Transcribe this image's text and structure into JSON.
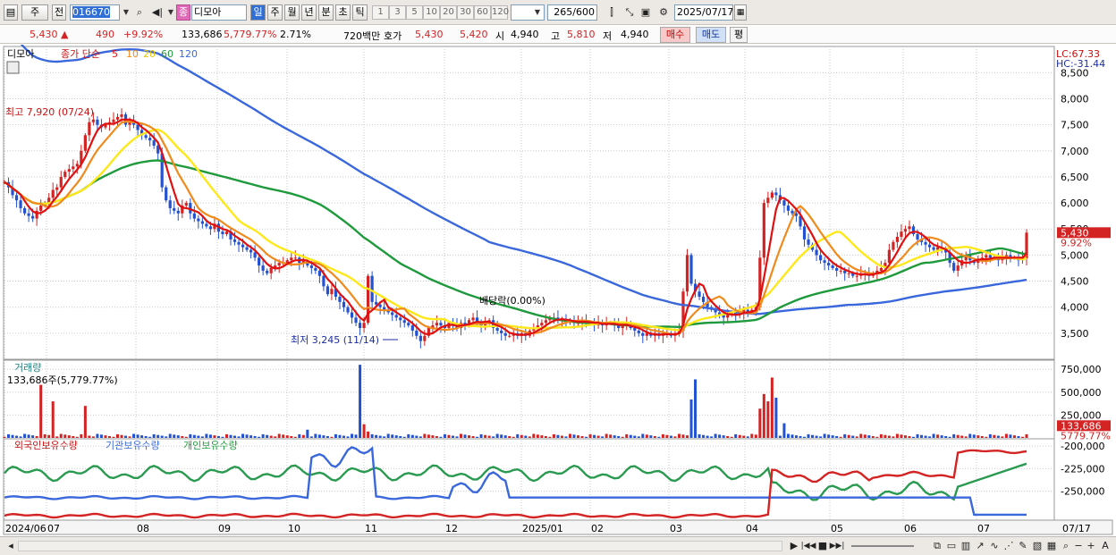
{
  "toolbar": {
    "market": "주",
    "prev": "전",
    "code": "016670",
    "name": "디모아",
    "name_tag": "종",
    "periods": [
      "일",
      "주",
      "월",
      "년",
      "분",
      "초",
      "틱"
    ],
    "intervals": [
      "1",
      "3",
      "5",
      "10",
      "20",
      "30",
      "60",
      "120"
    ],
    "count": "265",
    "count_total": "/600",
    "date": "2025/07/17"
  },
  "quote": {
    "price": "5,430",
    "arrow": "▲",
    "change": "490",
    "pct": "+9.92%",
    "volume": "133,686",
    "vol_ratio": "5,779.77%",
    "turnover": "2.71%",
    "amount": "720백만",
    "ask_label": "호가",
    "ask": "5,430",
    "bid": "5,420",
    "open_label": "시",
    "open": "4,940",
    "high_label": "고",
    "high": "5,810",
    "low_label": "저",
    "low": "4,940",
    "buy": "매수",
    "sell": "매도",
    "avg": "평"
  },
  "legend": {
    "name": "디모아",
    "price_label": "종가 단순",
    "ma": [
      "5",
      "10",
      "20",
      "60",
      "120"
    ]
  },
  "colors": {
    "up": "#d42323",
    "down": "#2251d1",
    "ma5": "#e01010",
    "ma10": "#f08a1c",
    "ma20": "#ffe81a",
    "ma60": "#1e9a3c",
    "ma120": "#3a68dc",
    "green": "#2a9a50",
    "grid": "#c9c9c9"
  },
  "chart_data": [
    {
      "type": "candlestick",
      "name": "price",
      "y_ticks": [
        "8,500",
        "8,000",
        "7,500",
        "7,000",
        "6,500",
        "6,000",
        "5,500",
        "5,000",
        "4,500",
        "4,000",
        "3,500"
      ],
      "ylim": [
        3000,
        8900
      ],
      "x_ticks": [
        "2024/06",
        "07",
        "08",
        "09",
        "10",
        "11",
        "12",
        "2025/01",
        "02",
        "03",
        "04",
        "05",
        "06",
        "07",
        "07/17"
      ],
      "close": [
        6400,
        6300,
        6150,
        6050,
        5900,
        5800,
        5750,
        5700,
        5850,
        5950,
        6000,
        6100,
        6250,
        6300,
        6500,
        6600,
        6650,
        6700,
        6750,
        7000,
        7300,
        7550,
        7600,
        7500,
        7450,
        7500,
        7550,
        7600,
        7650,
        7700,
        7500,
        7550,
        7500,
        7400,
        7300,
        7250,
        7200,
        7100,
        6950,
        6300,
        6050,
        5900,
        5850,
        5800,
        5950,
        6000,
        5800,
        5700,
        5650,
        5600,
        5550,
        5500,
        5600,
        5450,
        5400,
        5450,
        5300,
        5250,
        5200,
        5150,
        5100,
        5050,
        4950,
        4800,
        4700,
        4650,
        4750,
        4800,
        4850,
        4850,
        4900,
        4950,
        4950,
        4850,
        4900,
        4800,
        4750,
        4700,
        4600,
        4400,
        4250,
        4350,
        4200,
        4100,
        4000,
        3900,
        3800,
        3700,
        3600,
        3700,
        4600,
        4100,
        4050,
        4000,
        3950,
        3900,
        3850,
        3800,
        3750,
        3700,
        3650,
        3550,
        3450,
        3350,
        3450,
        3600,
        3650,
        3700,
        3650,
        3600,
        3700,
        3650,
        3600,
        3700,
        3650,
        3750,
        3800,
        3700,
        3650,
        3700,
        3750,
        3600,
        3550,
        3500,
        3450,
        3450,
        3500,
        3450,
        3500,
        3450,
        3550,
        3600,
        3650,
        3700,
        3750,
        3800,
        3800,
        3750,
        3750,
        3700,
        3750,
        3700,
        3700,
        3750,
        3700,
        3700,
        3650,
        3700,
        3650,
        3700,
        3700,
        3650,
        3600,
        3650,
        3700,
        3600,
        3550,
        3500,
        3450,
        3500,
        3450,
        3500,
        3450,
        3500,
        3500,
        3450,
        3500,
        3550,
        4300,
        5000,
        4450,
        4300,
        4200,
        4100,
        4000,
        3950,
        3900,
        3850,
        3800,
        3850,
        3900,
        3850,
        3900,
        3950,
        3900,
        3950,
        4000,
        4950,
        6000,
        6100,
        6200,
        6150,
        6050,
        5950,
        5850,
        5800,
        5750,
        5550,
        5300,
        5200,
        5100,
        5000,
        4900,
        4850,
        4800,
        4750,
        4700,
        4700,
        4650,
        4650,
        4600,
        4600,
        4650,
        4650,
        4600,
        4650,
        4700,
        4750,
        4850,
        5100,
        5250,
        5350,
        5450,
        5500,
        5550,
        5400,
        5300,
        5250,
        5200,
        5150,
        5100,
        5150,
        5100,
        5050,
        4850,
        4700,
        4800,
        4900,
        5000,
        4900,
        4850,
        4900,
        4950,
        5000,
        4950,
        4950,
        4900,
        4950,
        5000,
        4950,
        4950,
        4900,
        4940,
        5430
      ],
      "annotations": [
        {
          "text": "최고 7,920 (07/24)",
          "value": 7920
        },
        {
          "text": "최저 3,245 (11/14)",
          "value": 3245
        },
        {
          "text": "배당락(0.00%)"
        }
      ],
      "price_tag": "5,430",
      "pct_tag": "9.92%",
      "lc": "LC:67.33",
      "hc": "HC:-31.44"
    },
    {
      "type": "bar",
      "name": "volume",
      "title": "거래량",
      "subtitle": "133,686주(5,779.77%)",
      "y_ticks": [
        "750,000",
        "500,000",
        "250,000"
      ],
      "ylim": [
        0,
        850000
      ],
      "tag1": "133,686",
      "tag2": "5779.77%",
      "spikes": [
        {
          "i": 9,
          "v": 580000
        },
        {
          "i": 12,
          "v": 400000
        },
        {
          "i": 20,
          "v": 350000
        },
        {
          "i": 75,
          "v": 90000
        },
        {
          "i": 88,
          "v": 800000
        },
        {
          "i": 89,
          "v": 150000
        },
        {
          "i": 90,
          "v": 70000
        },
        {
          "i": 170,
          "v": 420000
        },
        {
          "i": 171,
          "v": 640000
        },
        {
          "i": 187,
          "v": 320000
        },
        {
          "i": 188,
          "v": 480000
        },
        {
          "i": 189,
          "v": 400000
        },
        {
          "i": 190,
          "v": 660000
        },
        {
          "i": 191,
          "v": 440000
        },
        {
          "i": 193,
          "v": 160000
        },
        {
          "i": 259,
          "v": 133686
        }
      ]
    },
    {
      "type": "line",
      "name": "holdings",
      "labels": [
        "외국인보유수량",
        "기관보유수량",
        "개인보유수량"
      ],
      "y_ticks": [
        "-200,000",
        "-225,000",
        "-250,000"
      ],
      "ylim": [
        -282000,
        -192000
      ]
    }
  ],
  "bottom": {
    "scroll": "◂",
    "play": "▶",
    "first": "|◀◀",
    "stop": "■",
    "last": "▶▶|"
  }
}
